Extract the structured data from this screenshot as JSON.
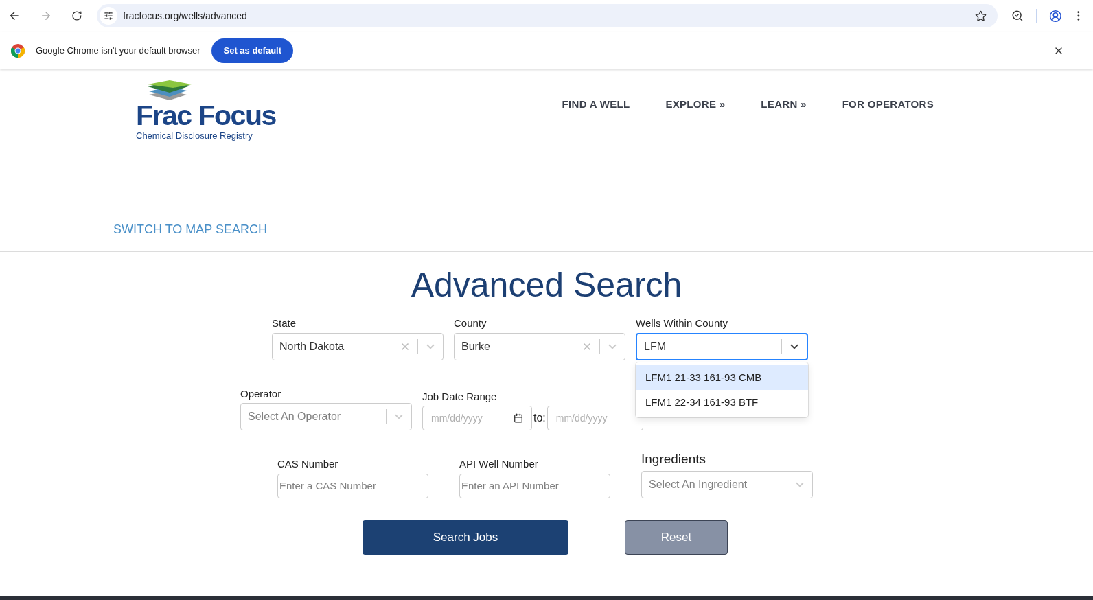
{
  "browser": {
    "url": "fracfocus.org/wells/advanced",
    "infobar": {
      "message": "Google Chrome isn't your default browser",
      "button": "Set as default"
    }
  },
  "header": {
    "logo": {
      "title": "Frac Focus",
      "subtitle": "Chemical Disclosure Registry"
    },
    "nav": [
      {
        "label": "FIND A WELL"
      },
      {
        "label": "EXPLORE »"
      },
      {
        "label": "LEARN »"
      },
      {
        "label": "FOR OPERATORS"
      }
    ]
  },
  "switch_link": "SWITCH TO MAP SEARCH",
  "title": "Advanced Search",
  "state": {
    "label": "State",
    "value": "North Dakota"
  },
  "county": {
    "label": "County",
    "value": "Burke"
  },
  "wells": {
    "label": "Wells Within County",
    "value": "LFM",
    "expanded": true,
    "options": [
      {
        "label": "LFM1 21-33 161-93 CMB",
        "selected": true
      },
      {
        "label": "LFM1 22-34 161-93 BTF",
        "selected": false
      }
    ]
  },
  "operator": {
    "label": "Operator",
    "placeholder": "Select An Operator"
  },
  "job_date_range": {
    "label": "Job Date Range",
    "from_placeholder": "mm/dd/yyyy",
    "separator": "to:",
    "to_placeholder": "mm/dd/yyyy"
  },
  "cas": {
    "label": "CAS Number",
    "placeholder": "Enter a CAS Number"
  },
  "api": {
    "label": "API Well Number",
    "placeholder": "Enter an API Number"
  },
  "ingredients": {
    "label": "Ingredients",
    "placeholder": "Select An Ingredient"
  },
  "buttons": {
    "search": "Search Jobs",
    "reset": "Reset"
  }
}
